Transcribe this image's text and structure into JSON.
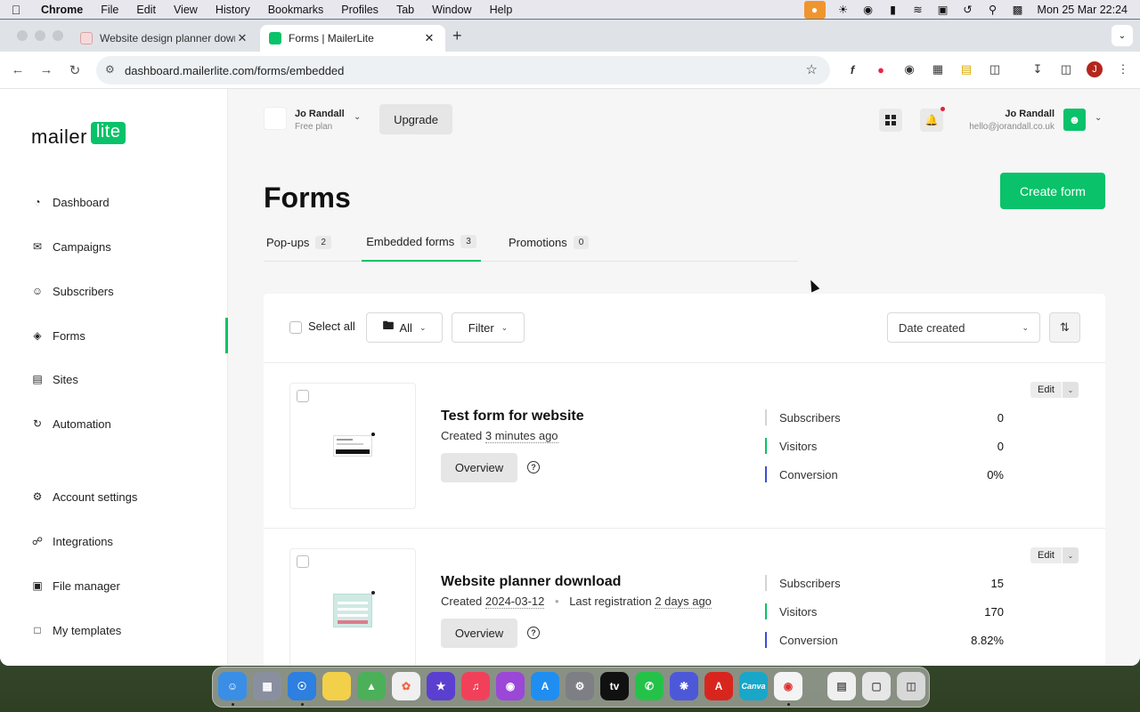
{
  "menubar": {
    "app_name": "Chrome",
    "items": [
      "File",
      "Edit",
      "View",
      "History",
      "Bookmarks",
      "Profiles",
      "Tab",
      "Window",
      "Help"
    ],
    "clock": "Mon 25 Mar  22:24"
  },
  "browser": {
    "tabs": [
      {
        "title": "Website design planner down",
        "active": false
      },
      {
        "title": "Forms | MailerLite",
        "active": true
      }
    ],
    "url": "dashboard.mailerlite.com/forms/embedded",
    "profile_initial": "J"
  },
  "sidebar": {
    "logo_text": "mailer",
    "logo_badge": "lite",
    "items": [
      {
        "label": "Dashboard",
        "icon": "clock-icon"
      },
      {
        "label": "Campaigns",
        "icon": "envelope-icon"
      },
      {
        "label": "Subscribers",
        "icon": "person-icon"
      },
      {
        "label": "Forms",
        "icon": "layers-icon",
        "active": true
      },
      {
        "label": "Sites",
        "icon": "browser-icon"
      },
      {
        "label": "Automation",
        "icon": "refresh-icon"
      },
      {
        "label": "Account settings",
        "icon": "gear-icon"
      },
      {
        "label": "Integrations",
        "icon": "link-icon"
      },
      {
        "label": "File manager",
        "icon": "image-icon"
      },
      {
        "label": "My templates",
        "icon": "lock-icon"
      }
    ]
  },
  "header": {
    "account_name": "Jo Randall",
    "account_plan": "Free plan",
    "upgrade_label": "Upgrade",
    "user_name": "Jo Randall",
    "user_email": "hello@jorandall.co.uk"
  },
  "page": {
    "title": "Forms",
    "create_label": "Create form",
    "tabs": [
      {
        "label": "Pop-ups",
        "count": "2"
      },
      {
        "label": "Embedded forms",
        "count": "3",
        "active": true
      },
      {
        "label": "Promotions",
        "count": "0"
      }
    ]
  },
  "filters": {
    "select_all": "Select all",
    "folder_label": "All",
    "filter_label": "Filter",
    "sort_label": "Date created"
  },
  "forms": [
    {
      "title": "Test form for website",
      "created_prefix": "Created",
      "created_value": "3 minutes ago",
      "last_registration": "",
      "overview_label": "Overview",
      "edit_label": "Edit",
      "stats": [
        {
          "label": "Subscribers",
          "value": "0",
          "color": "#d4d4d4"
        },
        {
          "label": "Visitors",
          "value": "0",
          "color": "#09c269"
        },
        {
          "label": "Conversion",
          "value": "0%",
          "color": "#3b4fd8"
        }
      ]
    },
    {
      "title": "Website planner download",
      "created_prefix": "Created",
      "created_value": "2024-03-12",
      "last_registration_prefix": "Last registration",
      "last_registration": "2 days ago",
      "overview_label": "Overview",
      "edit_label": "Edit",
      "stats": [
        {
          "label": "Subscribers",
          "value": "15",
          "color": "#d4d4d4"
        },
        {
          "label": "Visitors",
          "value": "170",
          "color": "#09c269"
        },
        {
          "label": "Conversion",
          "value": "8.82%",
          "color": "#3b4fd8"
        }
      ]
    }
  ],
  "colors": {
    "brand": "#09c269",
    "accent_blue": "#3b4fd8"
  }
}
